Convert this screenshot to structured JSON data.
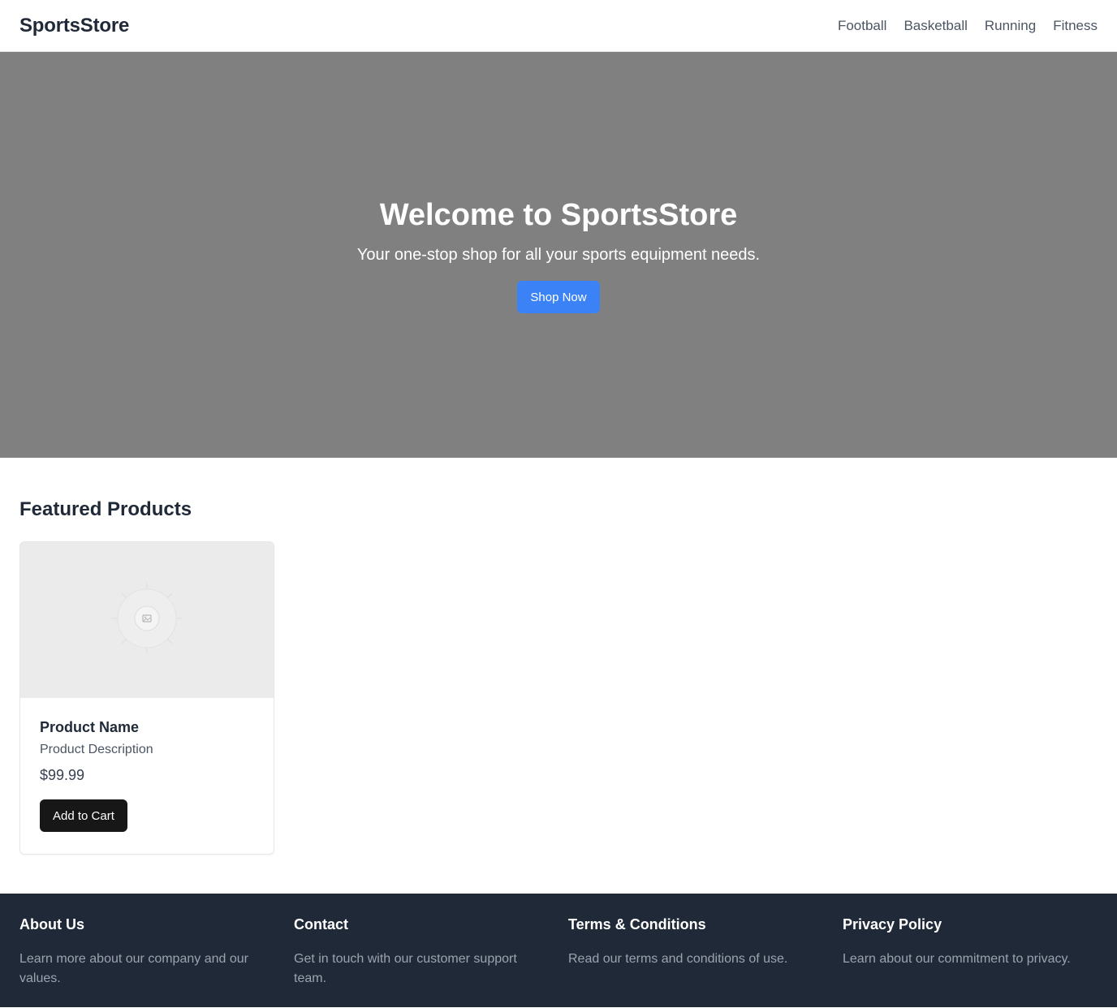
{
  "header": {
    "logo": "SportsStore",
    "nav": [
      "Football",
      "Basketball",
      "Running",
      "Fitness"
    ]
  },
  "hero": {
    "title": "Welcome to SportsStore",
    "subtitle": "Your one-stop shop for all your sports equipment needs.",
    "cta_label": "Shop Now",
    "background_color": "#808080",
    "cta_color": "#3b82f6"
  },
  "featured": {
    "title": "Featured Products",
    "products": [
      {
        "image_icon": "image-placeholder-icon",
        "name": "Product Name",
        "description": "Product Description",
        "price": "$99.99",
        "button_label": "Add to Cart"
      }
    ]
  },
  "footer": {
    "background_color": "#1f2937",
    "columns": [
      {
        "title": "About Us",
        "text": "Learn more about our company and our values."
      },
      {
        "title": "Contact",
        "text": "Get in touch with our customer support team."
      },
      {
        "title": "Terms & Conditions",
        "text": "Read our terms and conditions of use."
      },
      {
        "title": "Privacy Policy",
        "text": "Learn about our commitment to privacy."
      }
    ]
  }
}
